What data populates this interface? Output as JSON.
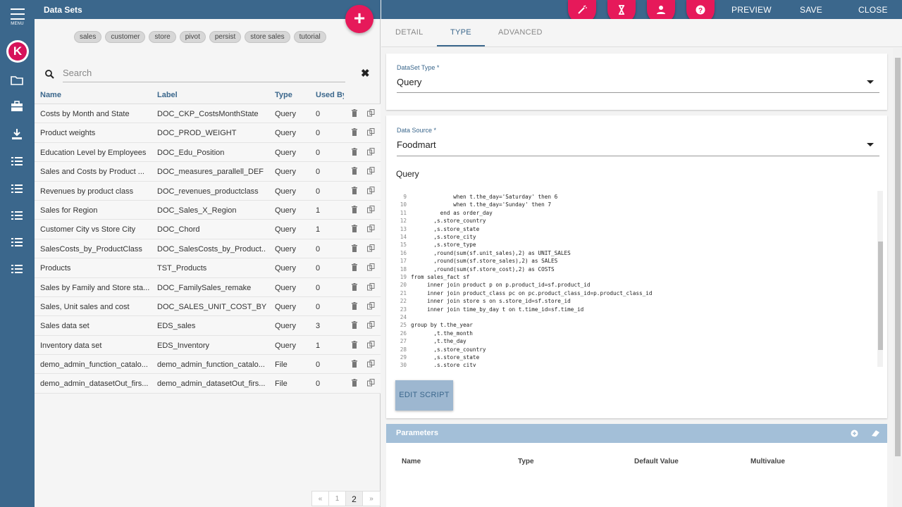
{
  "rail": {
    "menu_label": "MENU",
    "logo_letter": "K"
  },
  "left_panel": {
    "title": "Data Sets",
    "add_symbol": "+",
    "tags": [
      "sales",
      "customer",
      "store",
      "pivot",
      "persist",
      "store sales",
      "tutorial"
    ],
    "search": {
      "placeholder": "Search",
      "clear": "✖"
    },
    "columns": [
      "Name",
      "Label",
      "Type",
      "Used By"
    ],
    "rows": [
      {
        "name": "Costs by Month and State",
        "label": "DOC_CKP_CostsMonthState",
        "type": "Query",
        "used_by": "0"
      },
      {
        "name": "Product weights",
        "label": "DOC_PROD_WEIGHT",
        "type": "Query",
        "used_by": "0"
      },
      {
        "name": "Education Level by Employees",
        "label": "DOC_Edu_Position",
        "type": "Query",
        "used_by": "0"
      },
      {
        "name": "Sales and Costs by Product ...",
        "label": "DOC_measures_parallell_DEF",
        "type": "Query",
        "used_by": "0"
      },
      {
        "name": "Revenues by product class",
        "label": "DOC_revenues_productclass",
        "type": "Query",
        "used_by": "0"
      },
      {
        "name": "Sales for Region",
        "label": "DOC_Sales_X_Region",
        "type": "Query",
        "used_by": "1"
      },
      {
        "name": "Customer City vs Store City",
        "label": "DOC_Chord",
        "type": "Query",
        "used_by": "1"
      },
      {
        "name": "SalesCosts_by_ProductClass",
        "label": "DOC_SalesCosts_by_Product...",
        "type": "Query",
        "used_by": "0"
      },
      {
        "name": "Products",
        "label": "TST_Products",
        "type": "Query",
        "used_by": "0"
      },
      {
        "name": "Sales by Family and Store sta...",
        "label": "DOC_FamilySales_remake",
        "type": "Query",
        "used_by": "0"
      },
      {
        "name": "Sales, Unit sales and cost",
        "label": "DOC_SALES_UNIT_COST_BY_...",
        "type": "Query",
        "used_by": "0"
      },
      {
        "name": "Sales data set",
        "label": "EDS_sales",
        "type": "Query",
        "used_by": "3"
      },
      {
        "name": "Inventory data set",
        "label": "EDS_Inventory",
        "type": "Query",
        "used_by": "1"
      },
      {
        "name": "demo_admin_function_catalo...",
        "label": "demo_admin_function_catalo...",
        "type": "File",
        "used_by": "0"
      },
      {
        "name": "demo_admin_datasetOut_firs...",
        "label": "demo_admin_datasetOut_firs...",
        "type": "File",
        "used_by": "0"
      }
    ],
    "pager": {
      "prev": "«",
      "pages": [
        "1",
        "2"
      ],
      "next": "»"
    }
  },
  "right_header": {
    "preview": "PREVIEW",
    "save": "SAVE",
    "close": "CLOSE"
  },
  "tabs": [
    "DETAIL",
    "TYPE",
    "ADVANCED"
  ],
  "form": {
    "type_label": "DataSet Type *",
    "type_value": "Query",
    "source_label": "Data Source *",
    "source_value": "Foodmart",
    "query_label": "Query",
    "code_lines": [
      {
        "n": "9",
        "t": "             when t.the_day='Saturday' then 6"
      },
      {
        "n": "10",
        "t": "             when t.the_day='Sunday' then 7"
      },
      {
        "n": "11",
        "t": "         end as order_day"
      },
      {
        "n": "12",
        "t": "       ,s.store_country"
      },
      {
        "n": "13",
        "t": "       ,s.store_state"
      },
      {
        "n": "14",
        "t": "       ,s.store_city"
      },
      {
        "n": "15",
        "t": "       ,s.store_type"
      },
      {
        "n": "16",
        "t": "       ,round(sum(sf.unit_sales),2) as UNIT_SALES"
      },
      {
        "n": "17",
        "t": "       ,round(sum(sf.store_sales),2) as SALES"
      },
      {
        "n": "18",
        "t": "       ,round(sum(sf.store_cost),2) as COSTS"
      },
      {
        "n": "19",
        "t": "from sales_fact sf"
      },
      {
        "n": "20",
        "t": "     inner join product p on p.product_id=sf.product_id"
      },
      {
        "n": "21",
        "t": "     inner join product_class pc on pc.product_class_id=p.product_class_id"
      },
      {
        "n": "22",
        "t": "     inner join store s on s.store_id=sf.store_id"
      },
      {
        "n": "23",
        "t": "     inner join time_by_day t on t.time_id=sf.time_id"
      },
      {
        "n": "24",
        "t": ""
      },
      {
        "n": "25",
        "t": "group by t.the_year"
      },
      {
        "n": "26",
        "t": "       ,t.the_month"
      },
      {
        "n": "27",
        "t": "       ,t.the_day"
      },
      {
        "n": "28",
        "t": "       ,s.store_country"
      },
      {
        "n": "29",
        "t": "       ,s.store_state"
      },
      {
        "n": "30",
        "t": "       ,s.store_city"
      }
    ],
    "edit_script": "EDIT SCRIPT"
  },
  "parameters": {
    "title": "Parameters",
    "columns": [
      "Name",
      "Type",
      "Default Value",
      "Multivalue"
    ]
  },
  "colors": {
    "primary": "#3b678c",
    "accent": "#e6195a"
  }
}
